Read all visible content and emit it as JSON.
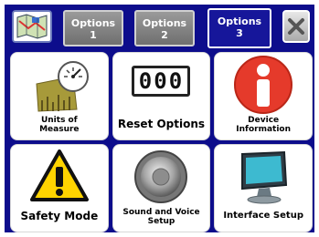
{
  "tabs": [
    {
      "line1": "Options",
      "line2": "1",
      "active": false
    },
    {
      "line1": "Options",
      "line2": "2",
      "active": false
    },
    {
      "line1": "Options",
      "line2": "3",
      "active": true
    }
  ],
  "grid": {
    "units": {
      "line1": "Units of",
      "line2": "Measure"
    },
    "reset": {
      "label": "Reset Options",
      "display": "000"
    },
    "device": {
      "line1": "Device",
      "line2": "Information"
    },
    "safety": {
      "label": "Safety Mode"
    },
    "sound": {
      "line1": "Sound and Voice",
      "line2": "Setup"
    },
    "interface": {
      "label": "Interface Setup"
    }
  },
  "colors": {
    "background": "#0d0d8c",
    "info_red": "#e53a2b",
    "warning_yellow": "#ffd400",
    "screen_cyan": "#3dbad0"
  },
  "icons": [
    "map-icon",
    "close-icon",
    "gauge-icon",
    "counter-icon",
    "info-icon",
    "warning-icon",
    "speaker-icon",
    "monitor-icon"
  ]
}
